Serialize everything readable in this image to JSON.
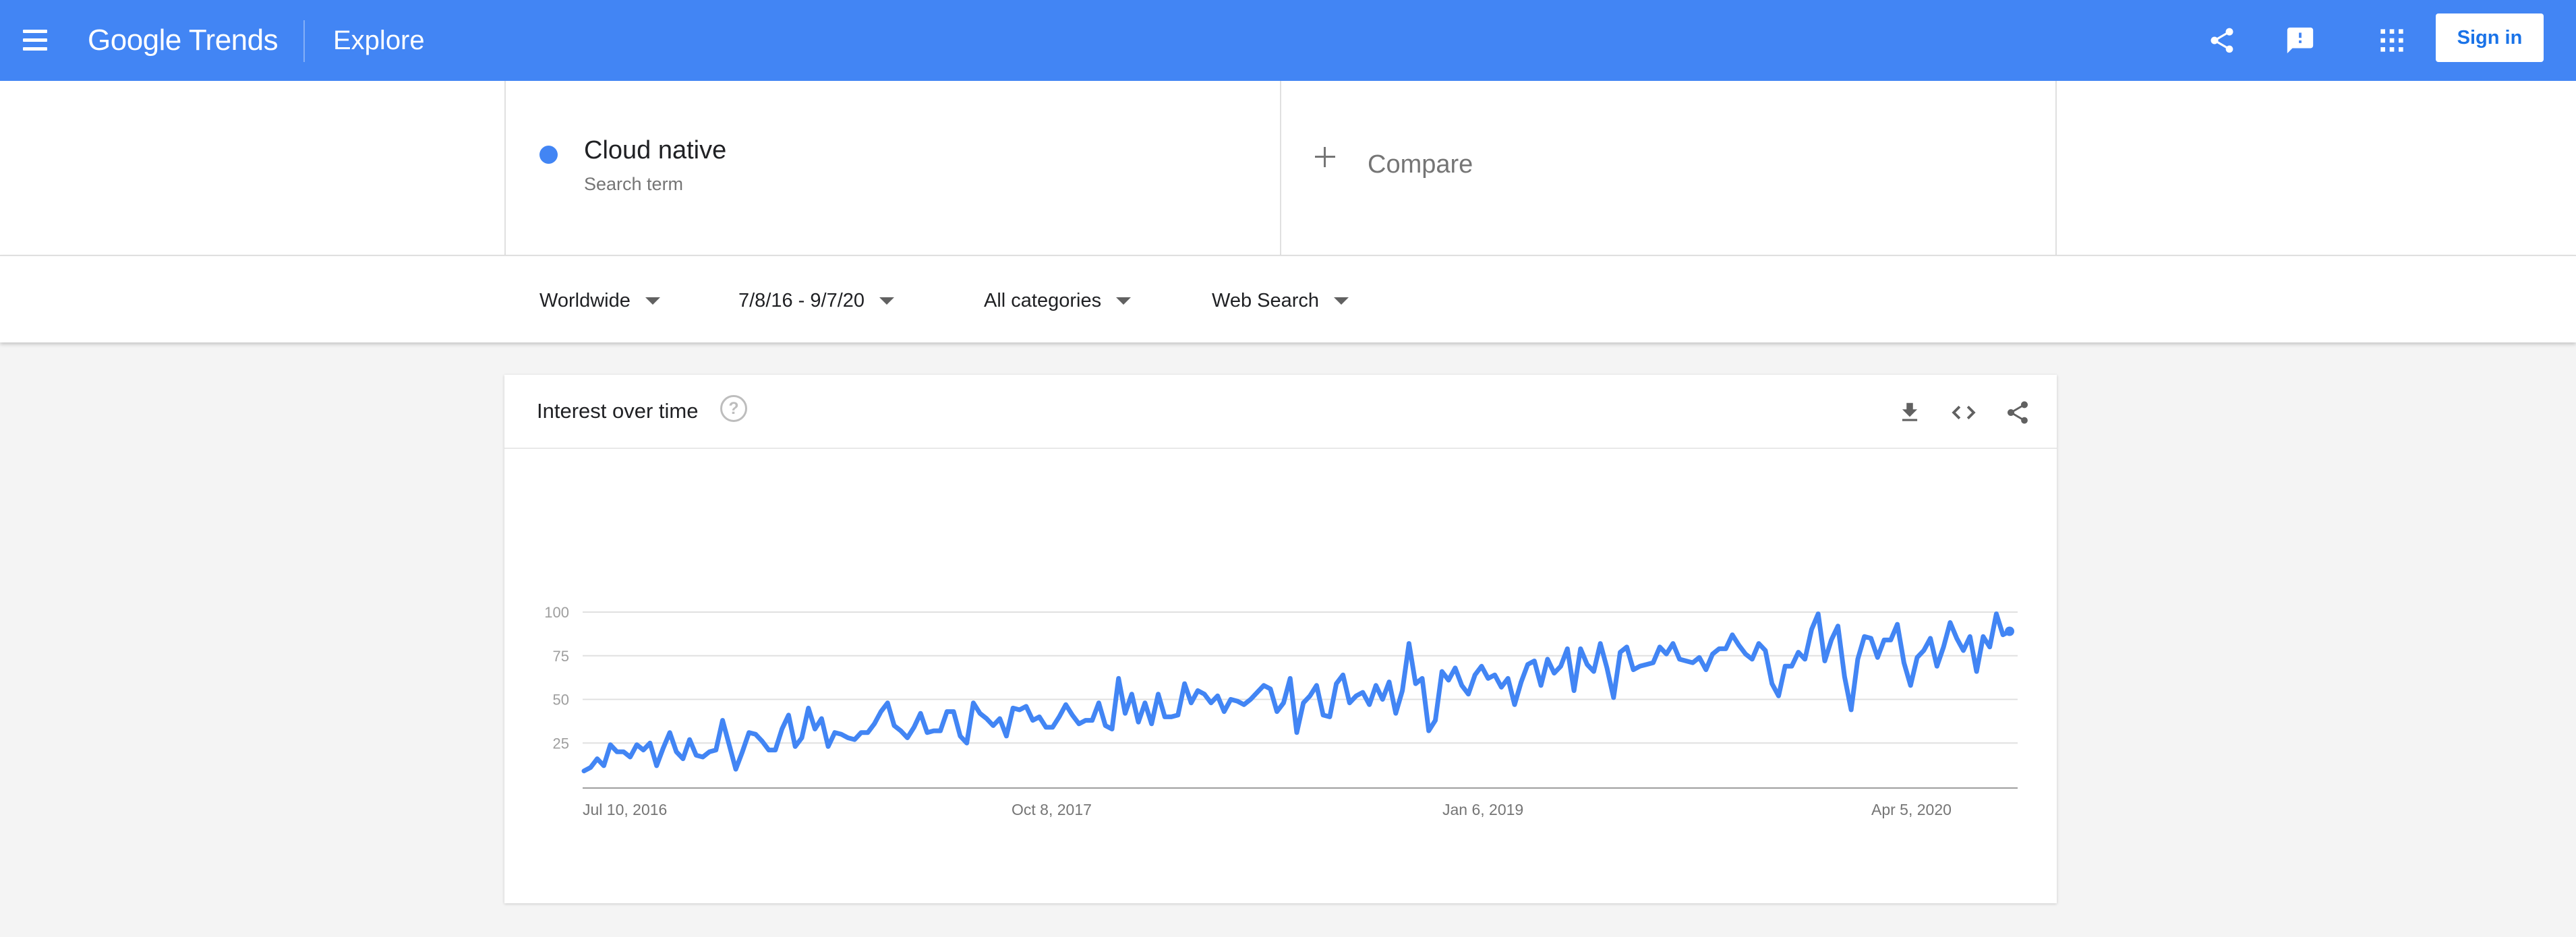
{
  "header": {
    "logo_text": "Google Trends",
    "page_title": "Explore",
    "sign_in_label": "Sign in",
    "icons": [
      "menu-icon",
      "share-icon",
      "feedback-icon",
      "apps-icon"
    ]
  },
  "search_terms": [
    {
      "label": "Cloud native",
      "type": "Search term",
      "color": "#4285f4"
    }
  ],
  "compare": {
    "label": "Compare"
  },
  "filters": {
    "region": "Worldwide",
    "date_range": "7/8/16 - 9/7/20",
    "category": "All categories",
    "search_type": "Web Search"
  },
  "card": {
    "title": "Interest over time",
    "help_icon": "help-icon",
    "actions": [
      "download-icon",
      "embed-code-icon",
      "share-icon"
    ]
  },
  "colors": {
    "header": "#4285f4",
    "series": "#4285f4",
    "sign_in_text": "#1a73e8"
  },
  "chart_data": {
    "type": "line",
    "title": "Interest over time",
    "ylim": [
      0,
      100
    ],
    "y_ticks": [
      25,
      50,
      75,
      100
    ],
    "x_tick_labels": [
      "Jul 10, 2016",
      "Oct 8, 2017",
      "Jan 6, 2019",
      "Apr 5, 2020"
    ],
    "grid": true,
    "series": [
      {
        "name": "Cloud native",
        "color": "#4285f4",
        "x_start": "Jul 10, 2016",
        "x_end": "Sep 6, 2020",
        "interval": "weekly",
        "values": [
          9,
          11,
          16,
          12,
          24,
          20,
          20,
          17,
          24,
          21,
          25,
          12,
          22,
          31,
          20,
          16,
          27,
          18,
          17,
          20,
          21,
          38,
          24,
          10,
          20,
          31,
          30,
          26,
          21,
          21,
          33,
          41,
          23,
          28,
          45,
          33,
          39,
          23,
          31,
          30,
          28,
          27,
          31,
          31,
          36,
          43,
          48,
          35,
          32,
          28,
          34,
          42,
          31,
          32,
          32,
          43,
          43,
          29,
          25,
          48,
          42,
          39,
          35,
          39,
          29,
          45,
          44,
          46,
          38,
          40,
          34,
          34,
          40,
          47,
          41,
          36,
          38,
          38,
          48,
          35,
          33,
          62,
          42,
          53,
          37,
          48,
          36,
          53,
          40,
          40,
          41,
          59,
          48,
          55,
          53,
          48,
          52,
          43,
          50,
          49,
          47,
          50,
          54,
          58,
          56,
          43,
          48,
          62,
          31,
          48,
          52,
          58,
          41,
          40,
          59,
          64,
          48,
          52,
          54,
          47,
          58,
          50,
          60,
          42,
          55,
          82,
          59,
          62,
          32,
          38,
          66,
          61,
          68,
          58,
          53,
          64,
          69,
          62,
          64,
          57,
          62,
          47,
          60,
          70,
          72,
          58,
          73,
          65,
          69,
          79,
          55,
          79,
          70,
          66,
          82,
          68,
          51,
          77,
          80,
          67,
          69,
          70,
          71,
          80,
          76,
          82,
          73,
          72,
          71,
          74,
          67,
          76,
          79,
          79,
          87,
          81,
          76,
          73,
          82,
          78,
          59,
          52,
          69,
          69,
          77,
          73,
          90,
          99,
          72,
          84,
          92,
          63,
          44,
          73,
          86,
          85,
          74,
          84,
          84,
          93,
          71,
          58,
          74,
          78,
          85,
          69,
          80,
          94,
          85,
          78,
          86,
          66,
          86,
          80,
          99,
          87,
          89
        ]
      }
    ]
  }
}
